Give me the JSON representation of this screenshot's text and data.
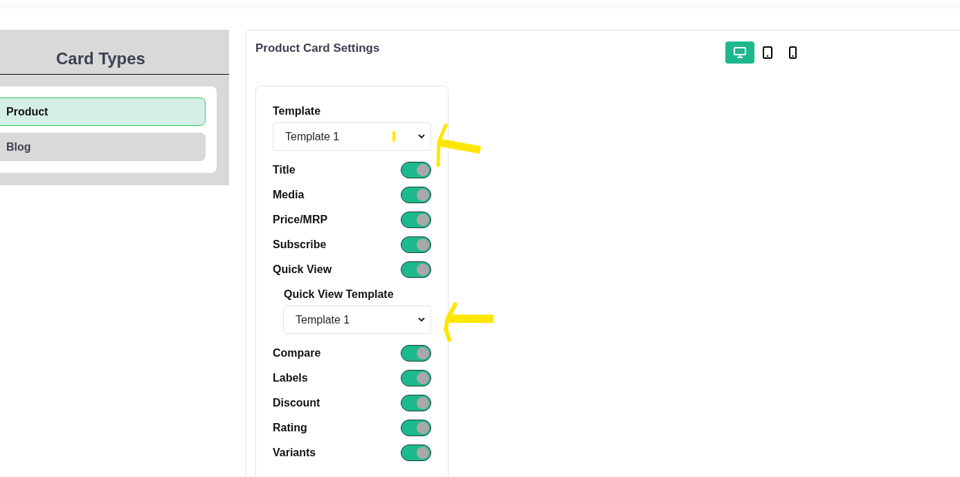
{
  "sidebar": {
    "title": "Card Types",
    "items": [
      {
        "label": "Product",
        "selected": true
      },
      {
        "label": "Blog",
        "selected": false
      }
    ]
  },
  "settings": {
    "title": "Product Card Settings",
    "device_buttons": [
      {
        "kind": "desktop",
        "selected": true
      },
      {
        "kind": "tablet",
        "selected": false
      },
      {
        "kind": "phone",
        "selected": false
      }
    ],
    "fields": [
      {
        "kind": "select",
        "label": "Template",
        "value": "Template 1",
        "highlighted": true
      },
      {
        "kind": "toggle",
        "label": "Title",
        "on": true
      },
      {
        "kind": "toggle",
        "label": "Media",
        "on": true
      },
      {
        "kind": "toggle",
        "label": "Price/MRP",
        "on": true
      },
      {
        "kind": "toggle",
        "label": "Subscribe",
        "on": true
      },
      {
        "kind": "toggle",
        "label": "Quick View",
        "on": true,
        "children": [
          {
            "kind": "select",
            "label": "Quick View Template",
            "value": "Template 1",
            "highlighted": true
          }
        ]
      },
      {
        "kind": "toggle",
        "label": "Compare",
        "on": true
      },
      {
        "kind": "toggle",
        "label": "Labels",
        "on": true
      },
      {
        "kind": "toggle",
        "label": "Discount",
        "on": true
      },
      {
        "kind": "toggle",
        "label": "Rating",
        "on": true
      },
      {
        "kind": "toggle",
        "label": "Variants",
        "on": true
      }
    ]
  }
}
